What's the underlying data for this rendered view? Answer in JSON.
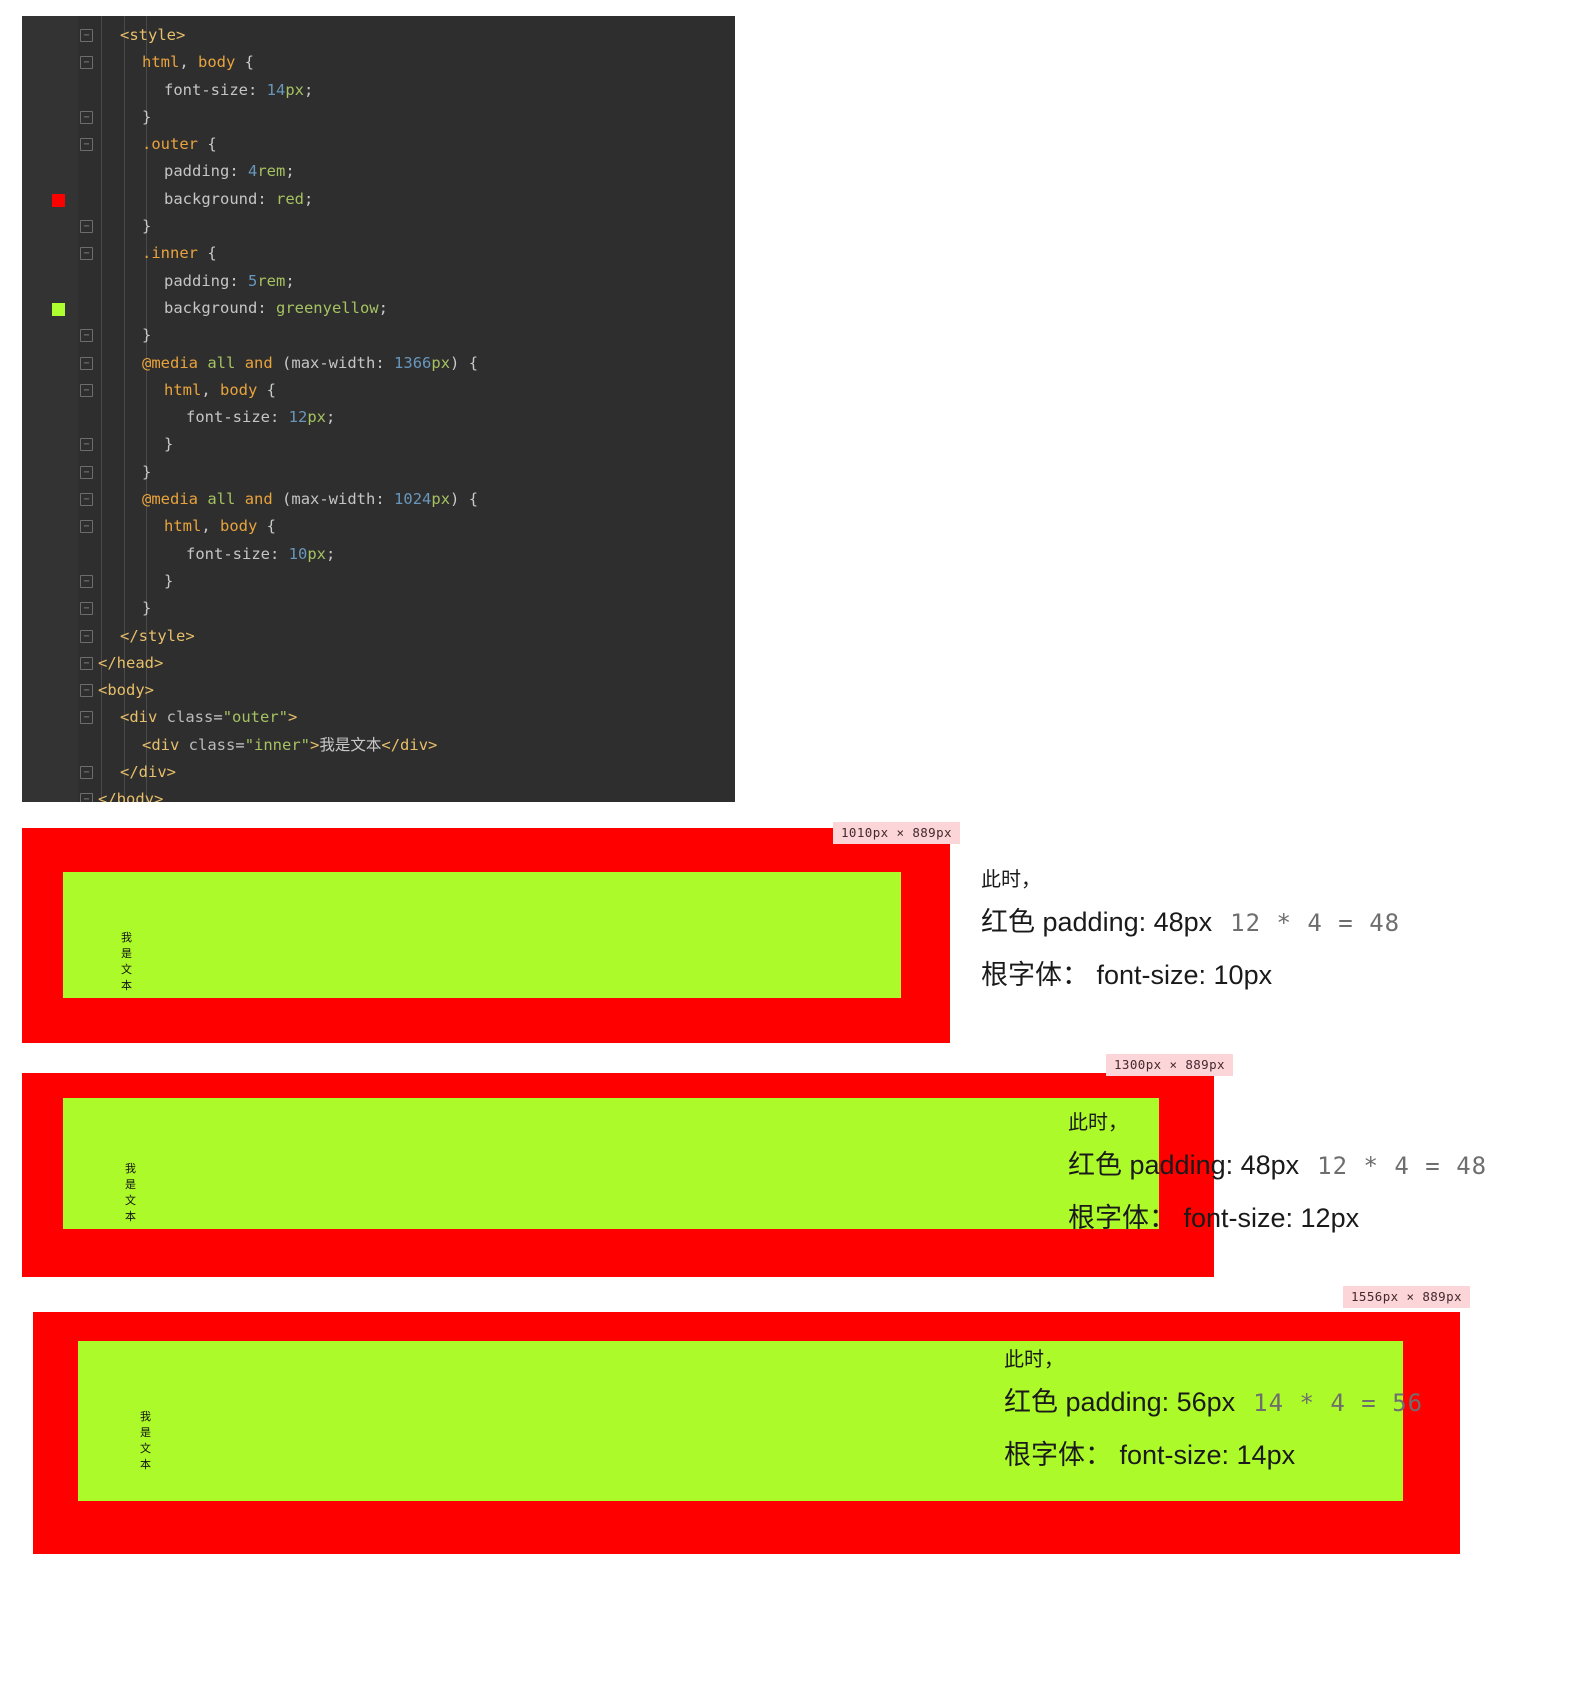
{
  "editor": {
    "language": "html",
    "lines": [
      {
        "indent": 1,
        "fold": "v",
        "tokens": [
          {
            "t": "tag",
            "s": "<style>"
          }
        ]
      },
      {
        "indent": 2,
        "fold": "v",
        "tokens": [
          {
            "t": "sel",
            "s": "html"
          },
          {
            "t": "punct",
            "s": ", "
          },
          {
            "t": "sel",
            "s": "body"
          },
          {
            "t": "punct",
            "s": " {"
          }
        ]
      },
      {
        "indent": 3,
        "tokens": [
          {
            "t": "prop",
            "s": "font-size: "
          },
          {
            "t": "num",
            "s": "14"
          },
          {
            "t": "unit",
            "s": "px"
          },
          {
            "t": "punct",
            "s": ";"
          }
        ]
      },
      {
        "indent": 2,
        "fold": "^",
        "tokens": [
          {
            "t": "punct",
            "s": "}"
          }
        ]
      },
      {
        "indent": 2,
        "fold": "v",
        "tokens": [
          {
            "t": "sel",
            "s": ".outer"
          },
          {
            "t": "punct",
            "s": " {"
          }
        ]
      },
      {
        "indent": 3,
        "tokens": [
          {
            "t": "prop",
            "s": "padding: "
          },
          {
            "t": "num",
            "s": "4"
          },
          {
            "t": "unit",
            "s": "rem"
          },
          {
            "t": "punct",
            "s": ";"
          }
        ]
      },
      {
        "indent": 3,
        "swatch": "#ff0000",
        "tokens": [
          {
            "t": "prop",
            "s": "background: "
          },
          {
            "t": "val",
            "s": "red"
          },
          {
            "t": "punct",
            "s": ";"
          }
        ]
      },
      {
        "indent": 2,
        "fold": "^",
        "tokens": [
          {
            "t": "punct",
            "s": "}"
          }
        ]
      },
      {
        "indent": 2,
        "fold": "v",
        "tokens": [
          {
            "t": "sel",
            "s": ".inner"
          },
          {
            "t": "punct",
            "s": " {"
          }
        ]
      },
      {
        "indent": 3,
        "tokens": [
          {
            "t": "prop",
            "s": "padding: "
          },
          {
            "t": "num",
            "s": "5"
          },
          {
            "t": "unit",
            "s": "rem"
          },
          {
            "t": "punct",
            "s": ";"
          }
        ]
      },
      {
        "indent": 3,
        "swatch": "#adff2f",
        "tokens": [
          {
            "t": "prop",
            "s": "background: "
          },
          {
            "t": "val",
            "s": "greenyellow"
          },
          {
            "t": "punct",
            "s": ";"
          }
        ]
      },
      {
        "indent": 2,
        "fold": "^",
        "tokens": [
          {
            "t": "punct",
            "s": "}"
          }
        ]
      },
      {
        "indent": 2,
        "fold": "v",
        "tokens": [
          {
            "t": "at",
            "s": "@media"
          },
          {
            "t": "punct",
            "s": " "
          },
          {
            "t": "unit",
            "s": "all"
          },
          {
            "t": "punct",
            "s": " "
          },
          {
            "t": "at",
            "s": "and"
          },
          {
            "t": "punct",
            "s": " ("
          },
          {
            "t": "prop",
            "s": "max-width"
          },
          {
            "t": "punct",
            "s": ": "
          },
          {
            "t": "num",
            "s": "1366"
          },
          {
            "t": "unit",
            "s": "px"
          },
          {
            "t": "punct",
            "s": ") {"
          }
        ]
      },
      {
        "indent": 3,
        "fold": "v",
        "tokens": [
          {
            "t": "sel",
            "s": "html"
          },
          {
            "t": "punct",
            "s": ", "
          },
          {
            "t": "sel",
            "s": "body"
          },
          {
            "t": "punct",
            "s": " {"
          }
        ]
      },
      {
        "indent": 4,
        "tokens": [
          {
            "t": "prop",
            "s": "font-size: "
          },
          {
            "t": "num",
            "s": "12"
          },
          {
            "t": "unit",
            "s": "px"
          },
          {
            "t": "punct",
            "s": ";"
          }
        ]
      },
      {
        "indent": 3,
        "fold": "^",
        "tokens": [
          {
            "t": "punct",
            "s": "}"
          }
        ]
      },
      {
        "indent": 2,
        "fold": "^",
        "tokens": [
          {
            "t": "punct",
            "s": "}"
          }
        ]
      },
      {
        "indent": 2,
        "fold": "v",
        "tokens": [
          {
            "t": "at",
            "s": "@media"
          },
          {
            "t": "punct",
            "s": " "
          },
          {
            "t": "unit",
            "s": "all"
          },
          {
            "t": "punct",
            "s": " "
          },
          {
            "t": "at",
            "s": "and"
          },
          {
            "t": "punct",
            "s": " ("
          },
          {
            "t": "prop",
            "s": "max-width"
          },
          {
            "t": "punct",
            "s": ": "
          },
          {
            "t": "num",
            "s": "1024"
          },
          {
            "t": "unit",
            "s": "px"
          },
          {
            "t": "punct",
            "s": ") {"
          }
        ]
      },
      {
        "indent": 3,
        "fold": "v",
        "tokens": [
          {
            "t": "sel",
            "s": "html"
          },
          {
            "t": "punct",
            "s": ", "
          },
          {
            "t": "sel",
            "s": "body"
          },
          {
            "t": "punct",
            "s": " {"
          }
        ]
      },
      {
        "indent": 4,
        "tokens": [
          {
            "t": "prop",
            "s": "font-size: "
          },
          {
            "t": "num",
            "s": "10"
          },
          {
            "t": "unit",
            "s": "px"
          },
          {
            "t": "punct",
            "s": ";"
          }
        ]
      },
      {
        "indent": 3,
        "fold": "^",
        "tokens": [
          {
            "t": "punct",
            "s": "}"
          }
        ]
      },
      {
        "indent": 2,
        "fold": "^",
        "tokens": [
          {
            "t": "punct",
            "s": "}"
          }
        ]
      },
      {
        "indent": 1,
        "fold": "^",
        "tokens": [
          {
            "t": "tag",
            "s": "</style>"
          }
        ]
      },
      {
        "indent": 0,
        "fold": "^",
        "tokens": [
          {
            "t": "tag",
            "s": "</head>"
          }
        ]
      },
      {
        "indent": 0,
        "fold": "v",
        "tokens": [
          {
            "t": "tag",
            "s": "<body>"
          }
        ]
      },
      {
        "indent": 1,
        "fold": "v",
        "tokens": [
          {
            "t": "tag",
            "s": "<div "
          },
          {
            "t": "attr",
            "s": "class"
          },
          {
            "t": "punct",
            "s": "="
          },
          {
            "t": "str",
            "s": "\"outer\""
          },
          {
            "t": "tag",
            "s": ">"
          }
        ]
      },
      {
        "indent": 2,
        "tokens": [
          {
            "t": "tag",
            "s": "<div "
          },
          {
            "t": "attr",
            "s": "class"
          },
          {
            "t": "punct",
            "s": "="
          },
          {
            "t": "str",
            "s": "\"inner\""
          },
          {
            "t": "tag",
            "s": ">"
          },
          {
            "t": "cn",
            "s": "我是文本"
          },
          {
            "t": "tag",
            "s": "</div>"
          }
        ]
      },
      {
        "indent": 1,
        "fold": "^",
        "tokens": [
          {
            "t": "tag",
            "s": "</div>"
          }
        ]
      },
      {
        "indent": 0,
        "fold": "^",
        "tokens": [
          {
            "t": "tag",
            "s": "</body>"
          }
        ]
      }
    ]
  },
  "panels": [
    {
      "id": "panel-1010",
      "badge": "1010px × 889px",
      "inner_text": "我是文本",
      "note_lines": [
        {
          "parts": [
            {
              "k": "cn",
              "s": "此时，"
            }
          ]
        },
        {
          "parts": [
            {
              "k": "cn",
              "s": "红色"
            },
            {
              "k": "en",
              "s": " padding: 48px"
            },
            {
              "k": "calc",
              "s": "12 * 4 = 48"
            }
          ]
        },
        {
          "parts": [
            {
              "k": "cn",
              "s": "根字体："
            },
            {
              "k": "en",
              "s": " font-size: 10px"
            }
          ]
        }
      ]
    },
    {
      "id": "panel-1300",
      "badge": "1300px × 889px",
      "inner_text": "我是文本",
      "note_lines": [
        {
          "parts": [
            {
              "k": "cn",
              "s": "此时，"
            }
          ]
        },
        {
          "parts": [
            {
              "k": "cn",
              "s": "红色"
            },
            {
              "k": "en",
              "s": " padding: 48px"
            },
            {
              "k": "calc",
              "s": "12 * 4 = 48"
            }
          ]
        },
        {
          "parts": [
            {
              "k": "cn",
              "s": "根字体："
            },
            {
              "k": "en",
              "s": " font-size: 12px"
            }
          ]
        }
      ]
    },
    {
      "id": "panel-1556",
      "badge": "1556px × 889px",
      "inner_text": "我是文本",
      "note_lines": [
        {
          "parts": [
            {
              "k": "cn",
              "s": "此时，"
            }
          ]
        },
        {
          "parts": [
            {
              "k": "cn",
              "s": "红色"
            },
            {
              "k": "en",
              "s": " padding: 56px"
            },
            {
              "k": "calc",
              "s": "14 * 4 = 56"
            }
          ]
        },
        {
          "parts": [
            {
              "k": "cn",
              "s": "根字体："
            },
            {
              "k": "en",
              "s": " font-size: 14px"
            }
          ]
        }
      ]
    }
  ],
  "colors": {
    "outer_bg": "#ff0000",
    "inner_bg": "#adfa2a",
    "badge_bg": "#fbd5d8",
    "editor_bg": "#2e2e2e"
  }
}
